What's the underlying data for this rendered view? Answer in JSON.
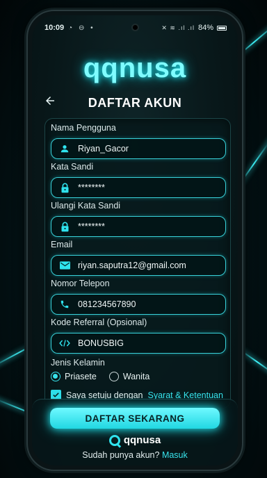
{
  "status_bar": {
    "time": "10:09",
    "battery": "84%"
  },
  "brand": {
    "logo_text": "qqnusa",
    "mini_logo_text": "qqnusa"
  },
  "header": {
    "title": "DAFTAR AKUN"
  },
  "form": {
    "username": {
      "label": "Nama Pengguna",
      "value": "Riyan_Gacor",
      "icon": "user-icon"
    },
    "password": {
      "label": "Kata Sandi",
      "value": "********",
      "icon": "lock-icon"
    },
    "confirm_password": {
      "label": "Ulangi Kata Sandi",
      "value": "********",
      "icon": "lock-icon"
    },
    "email": {
      "label": "Email",
      "value": "riyan.saputra12@gmail.com",
      "icon": "mail-icon"
    },
    "phone": {
      "label": "Nomor Telepon",
      "value": "081234567890",
      "icon": "phone-icon"
    },
    "referral": {
      "label": "Kode Referral (Opsional)",
      "value": "BONUSBIG",
      "icon": "code-icon"
    },
    "gender": {
      "label": "Jenis Kelamin",
      "options": [
        "Priasete",
        "Wanita"
      ],
      "selected": "Priasete"
    },
    "agree": {
      "text": "Saya setuju dengan",
      "link": "Syarat & Ketentuan",
      "checked": true
    }
  },
  "footer": {
    "cta_label": "DAFTAR SEKARANG",
    "login_prompt": "Sudah punya akun?",
    "login_link": "Masuk"
  },
  "colors": {
    "accent": "#2fe3ee",
    "glow": "#7ffcff",
    "background": "#081719"
  }
}
